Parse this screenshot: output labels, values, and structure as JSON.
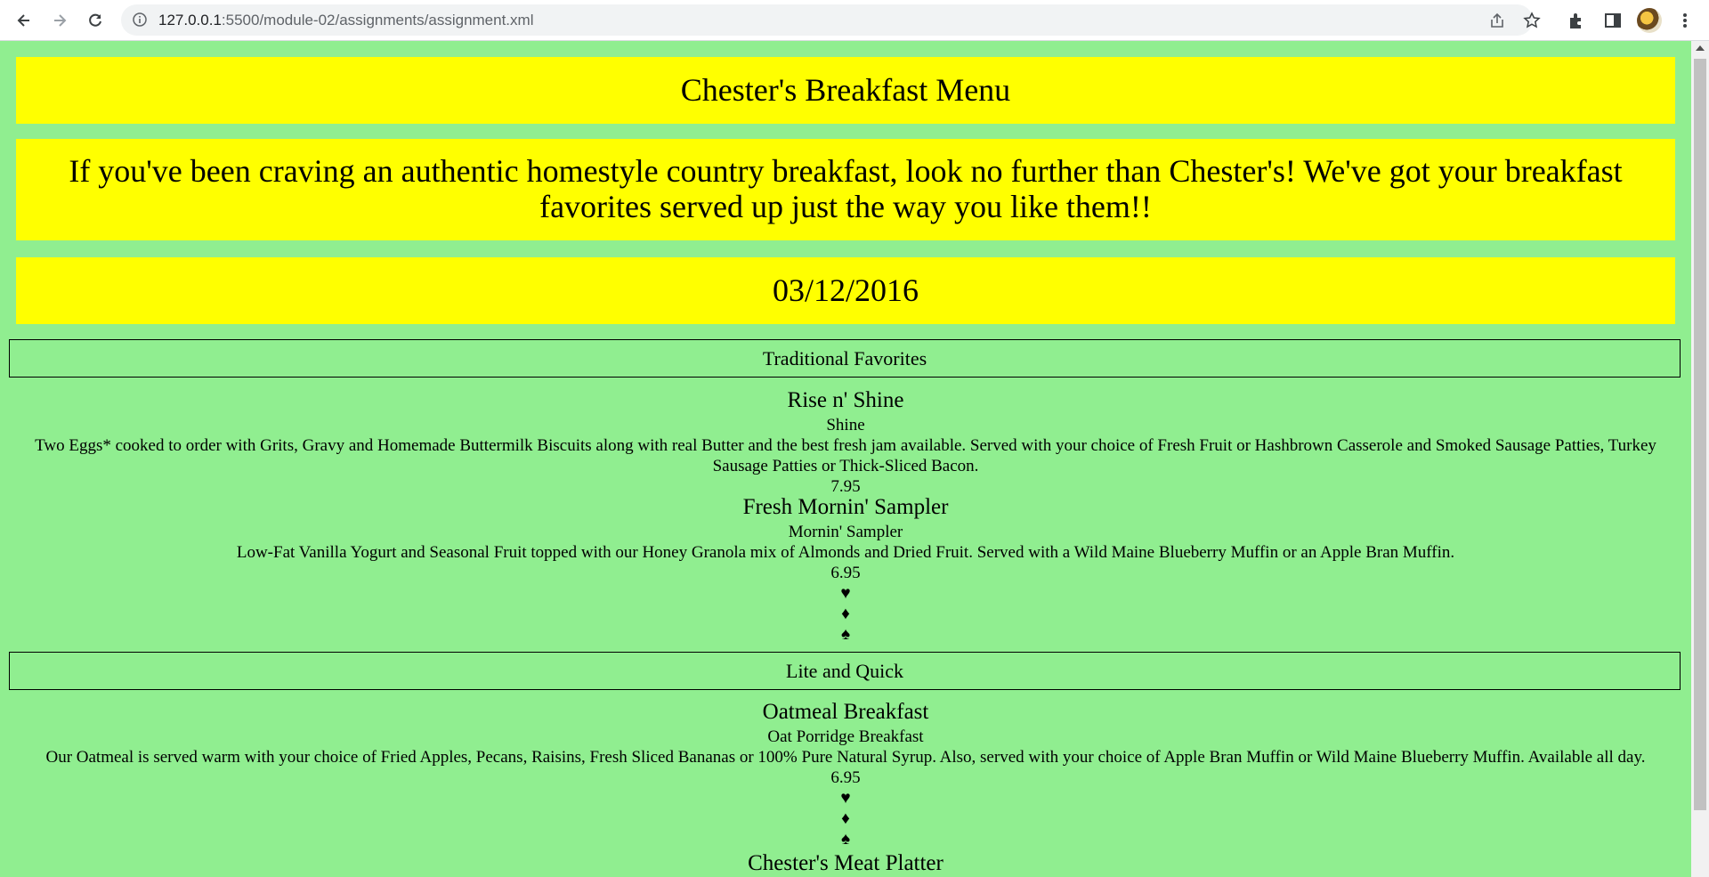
{
  "browser": {
    "url_host": "127.0.0.1",
    "url_path": ":5500/module-02/assignments/assignment.xml"
  },
  "menu": {
    "title": "Chester's Breakfast Menu",
    "intro": "If you've been craving an authentic homestyle country breakfast, look no further than Chester's! We've got your breakfast favorites served up just the way you like them!!",
    "date": "03/12/2016",
    "sections": [
      {
        "name": "Traditional Favorites",
        "items": [
          {
            "name": "Rise n' Shine",
            "short": "Shine",
            "description": "Two Eggs* cooked to order with Grits, Gravy and Homemade Buttermilk Biscuits along with real Butter and the best fresh jam available. Served with your choice of Fresh Fruit or Hashbrown Casserole and Smoked Sausage Patties, Turkey Sausage Patties or Thick-Sliced Bacon.",
            "price": "7.95"
          },
          {
            "name": "Fresh Mornin' Sampler",
            "short": "Mornin' Sampler",
            "description": "Low-Fat Vanilla Yogurt and Seasonal Fruit topped with our Honey Granola mix of Almonds and Dried Fruit. Served with a Wild Maine Blueberry Muffin or an Apple Bran Muffin.",
            "price": "6.95"
          }
        ]
      },
      {
        "name": "Lite and Quick",
        "items": [
          {
            "name": "Oatmeal Breakfast",
            "short": "Oat Porridge Breakfast",
            "description": "Our Oatmeal is served warm with your choice of Fried Apples, Pecans, Raisins, Fresh Sliced Bananas or 100% Pure Natural Syrup. Also, served with your choice of Apple Bran Muffin or Wild Maine Blueberry Muffin. Available all day.",
            "price": "6.95"
          },
          {
            "name": "Chester's Meat Platter"
          }
        ]
      }
    ],
    "suits": [
      "♥",
      "♦",
      "♠"
    ]
  }
}
